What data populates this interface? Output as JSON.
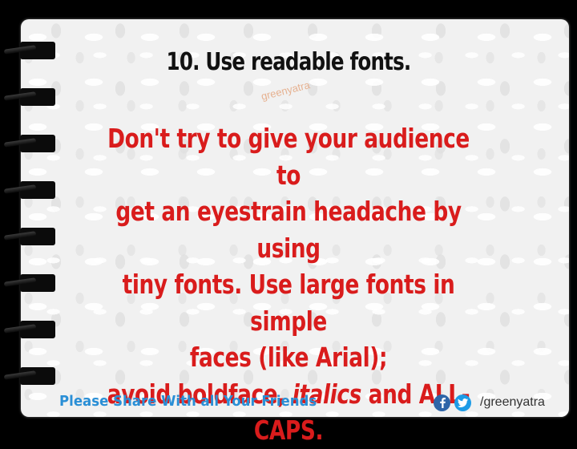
{
  "slide": {
    "title": "10. Use readable fonts.",
    "watermark": "greenyatra",
    "body": {
      "line1": "Don't try to give your audience to",
      "line2": "get an eyestrain headache by using",
      "line3": "tiny fonts. Use large fonts in simple",
      "line4": "faces (like Arial);",
      "line5_before": "avoid boldface, ",
      "line5_italic": "italics",
      "line5_after": " and ALL-",
      "line6": "CAPS."
    },
    "footer": {
      "share_text": "Please Share With all Your Friends",
      "handle": "/greenyatra",
      "icons": [
        "facebook-icon",
        "twitter-icon"
      ]
    }
  },
  "colors": {
    "background": "#000000",
    "card": "#f1f1f1",
    "title": "#111111",
    "body_text": "#d91c1c",
    "share_text": "#2a8fd6",
    "facebook": "#2f65a8",
    "twitter": "#1d9be6"
  }
}
